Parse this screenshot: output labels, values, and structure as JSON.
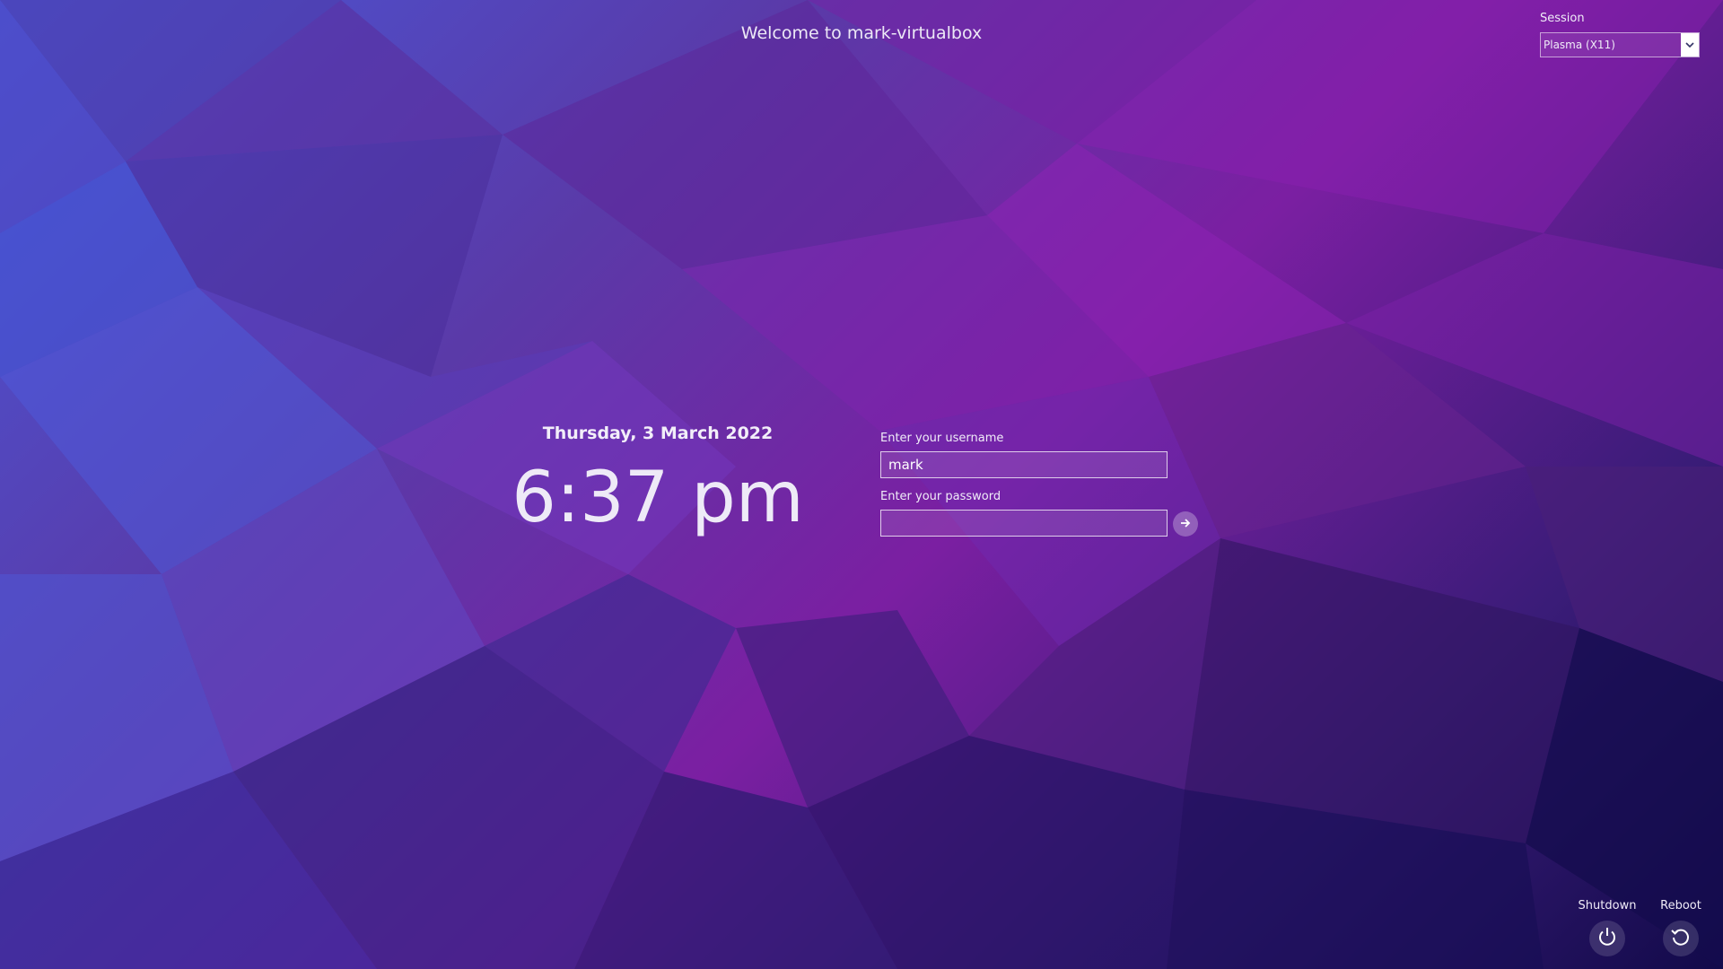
{
  "header": {
    "welcome_text": "Welcome to mark-virtualbox"
  },
  "session": {
    "label": "Session",
    "selected": "Plasma (X11)"
  },
  "clock": {
    "date": "Thursday, 3 March 2022",
    "time": "6:37 pm"
  },
  "login": {
    "username_label": "Enter your username",
    "username_value": "mark",
    "password_label": "Enter your password",
    "password_value": ""
  },
  "power": {
    "shutdown_label": "Shutdown",
    "reboot_label": "Reboot"
  },
  "icons": {
    "session_dropdown": "chevron-down-icon",
    "login_submit": "arrow-right-icon",
    "shutdown": "power-icon",
    "reboot": "reboot-icon"
  },
  "colors": {
    "accent_purple": "#7b1fa2",
    "accent_blue": "#4a56d6",
    "deep_navy": "#120a4a"
  }
}
